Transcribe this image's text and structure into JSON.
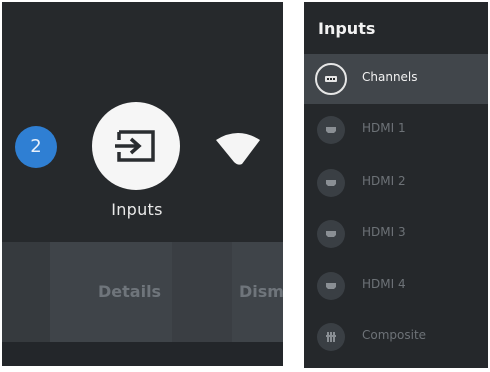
{
  "home_row": {
    "notification_count": "2",
    "inputs_label": "Inputs",
    "icons": [
      "notification-badge",
      "input-source-icon",
      "wifi-icon"
    ]
  },
  "action_bar": {
    "details_label": "Details",
    "dismiss_label": "Dism"
  },
  "inputs_panel": {
    "title": "Inputs",
    "items": [
      {
        "label": "Channels",
        "icon": "tv-channels-icon",
        "selected": true
      },
      {
        "label": "HDMI 1",
        "icon": "hdmi-icon",
        "selected": false
      },
      {
        "label": "HDMI 2",
        "icon": "hdmi-icon",
        "selected": false
      },
      {
        "label": "HDMI 3",
        "icon": "hdmi-icon",
        "selected": false
      },
      {
        "label": "HDMI 4",
        "icon": "hdmi-icon",
        "selected": false
      },
      {
        "label": "Composite",
        "icon": "composite-icon",
        "selected": false
      }
    ]
  },
  "colors": {
    "badge_blue": "#2f7fd3",
    "panel_bg": "#25282b",
    "selected_row": "#41464b"
  }
}
